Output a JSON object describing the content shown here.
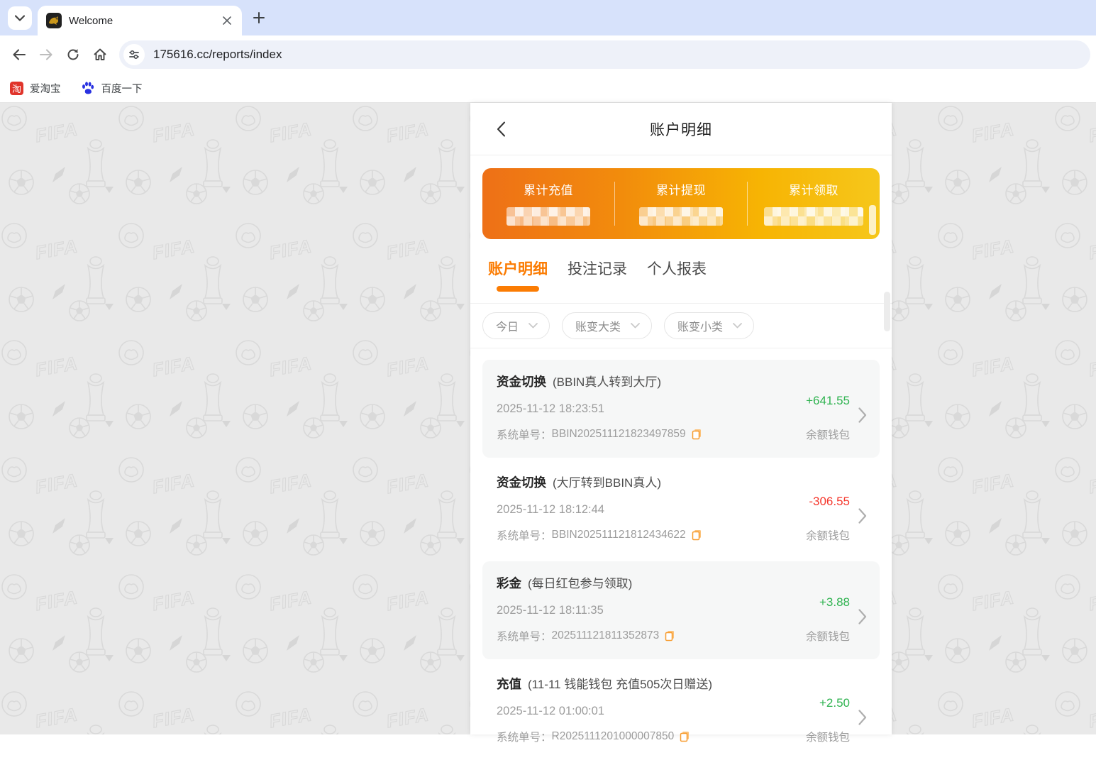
{
  "browser": {
    "tab_title": "Welcome",
    "url": "175616.cc/reports/index",
    "bookmarks": [
      {
        "label": "爱淘宝",
        "icon": "taobao-icon",
        "icon_glyph": "淘",
        "icon_color": "#e0342b"
      },
      {
        "label": "百度一下",
        "icon": "baidu-paw-icon",
        "icon_color": "#2932e1"
      }
    ]
  },
  "page": {
    "title": "账户明细",
    "stats": [
      {
        "label": "累计充值",
        "value_masked": true
      },
      {
        "label": "累计提现",
        "value_masked": true
      },
      {
        "label": "累计领取",
        "value_masked": true
      }
    ],
    "tabs": [
      {
        "label": "账户明细",
        "active": true
      },
      {
        "label": "投注记录",
        "active": false
      },
      {
        "label": "个人报表",
        "active": false
      }
    ],
    "filters": [
      {
        "label": "今日"
      },
      {
        "label": "账变大类"
      },
      {
        "label": "账变小类"
      }
    ],
    "order_label": "系统单号：",
    "list": [
      {
        "type": "资金切换",
        "desc": "(BBIN真人转到大厅)",
        "time": "2025-11-12 18:23:51",
        "order": "BBIN202511121823497859",
        "amount": "+641.55",
        "direction": "in",
        "wallet": "余额钱包"
      },
      {
        "type": "资金切换",
        "desc": "(大厅转到BBIN真人)",
        "time": "2025-11-12 18:12:44",
        "order": "BBIN202511121812434622",
        "amount": "-306.55",
        "direction": "out",
        "wallet": "余额钱包"
      },
      {
        "type": "彩金",
        "desc": "(每日红包参与领取)",
        "time": "2025-11-12 18:11:35",
        "order": "202511121811352873",
        "amount": "+3.88",
        "direction": "in",
        "wallet": "余额钱包"
      },
      {
        "type": "充值",
        "desc": "(11-11 钱能钱包 充值505次日赠送)",
        "time": "2025-11-12 01:00:01",
        "order": "R2025111201000007850",
        "amount": "+2.50",
        "direction": "in",
        "wallet": "余额钱包"
      }
    ]
  },
  "colors": {
    "accent_orange": "#fb7c03",
    "card_gradient_left": "#ee7017",
    "card_gradient_right": "#f6c71b",
    "amount_green": "#2fb350",
    "amount_red": "#f5372c",
    "copy_icon_orange": "#f79b2e",
    "tabstrip_blue": "#d7e2fb"
  }
}
